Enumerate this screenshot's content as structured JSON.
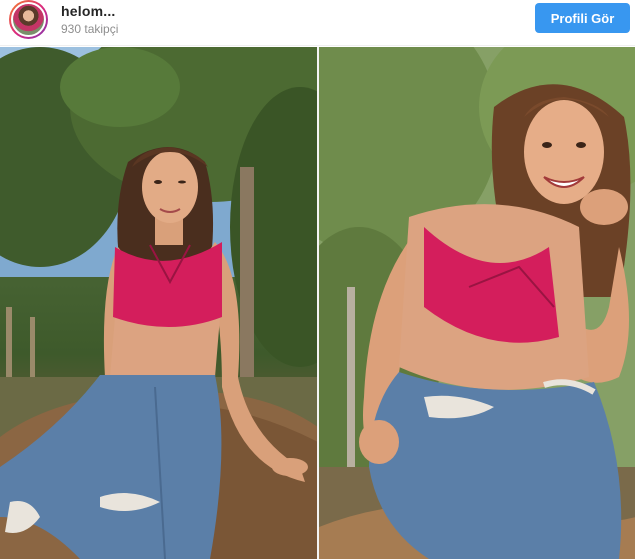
{
  "header": {
    "username": "helom...",
    "followers": "930 takipçi",
    "view_profile_label": "Profili Gör"
  },
  "colors": {
    "accent": "#3897f0",
    "top": "#d41e5c",
    "jeans": "#5b7fa8"
  },
  "photos": [
    {
      "name": "left-photo",
      "subject": "woman in pink crop top and ripped jeans sitting on rock"
    },
    {
      "name": "right-photo",
      "subject": "woman in pink crop top and ripped jeans smiling, leaning forward"
    }
  ]
}
